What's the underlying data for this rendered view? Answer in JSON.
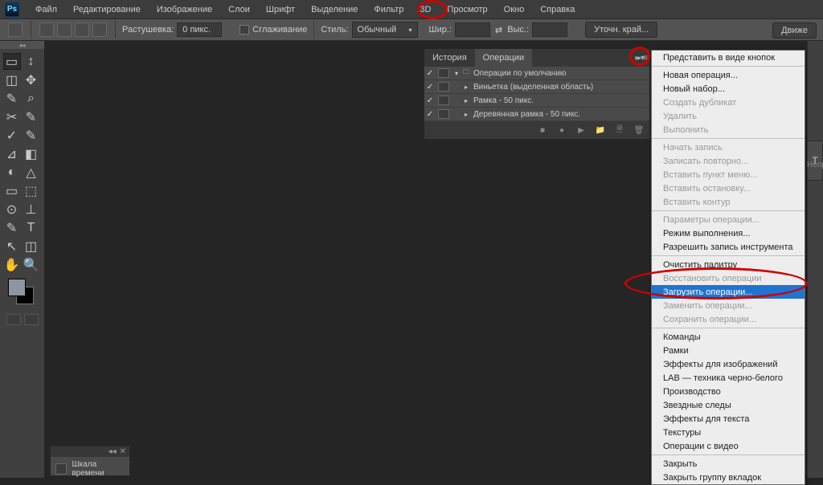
{
  "app": {
    "logo": "Ps"
  },
  "menubar": {
    "items": [
      "Файл",
      "Редактирование",
      "Изображение",
      "Слои",
      "Шрифт",
      "Выделение",
      "Фильтр",
      "3D",
      "Просмотр",
      "Окно",
      "Справка"
    ]
  },
  "optionsbar": {
    "feather_label": "Растушевка:",
    "feather_value": "0 пикс.",
    "antialias": "Сглаживание",
    "style_label": "Стиль:",
    "style_value": "Обычный",
    "width_label": "Шир.:",
    "height_label": "Выс.:",
    "refine_edge": "Уточн. край...",
    "right_btn": "Движе"
  },
  "panel": {
    "tabs": [
      "История",
      "Операции"
    ],
    "active_tab": 1,
    "rows": [
      {
        "label": "Операции по умолчанию",
        "indent": 0,
        "folder": true
      },
      {
        "label": "Виньетка (выделенная область)",
        "indent": 1,
        "folder": false
      },
      {
        "label": "Рамка - 50 пикс.",
        "indent": 1,
        "folder": false
      },
      {
        "label": "Деревянная рамка - 50 пикс.",
        "indent": 1,
        "folder": false
      }
    ],
    "footer_icons": [
      "■",
      "●",
      "▶",
      "📁",
      "🗎",
      "🗑"
    ]
  },
  "flymenu": {
    "groups": [
      [
        {
          "label": "Представить в виде кнопок",
          "disabled": false
        }
      ],
      [
        {
          "label": "Новая операция...",
          "disabled": false
        },
        {
          "label": "Новый набор...",
          "disabled": false
        },
        {
          "label": "Создать дубликат",
          "disabled": true
        },
        {
          "label": "Удалить",
          "disabled": true
        },
        {
          "label": "Выполнить",
          "disabled": true
        }
      ],
      [
        {
          "label": "Начать запись",
          "disabled": true
        },
        {
          "label": "Записать повторно...",
          "disabled": true
        },
        {
          "label": "Вставить пункт меню...",
          "disabled": true
        },
        {
          "label": "Вставить остановку...",
          "disabled": true
        },
        {
          "label": "Вставить контур",
          "disabled": true
        }
      ],
      [
        {
          "label": "Параметры операции...",
          "disabled": true
        },
        {
          "label": "Режим выполнения...",
          "disabled": false
        },
        {
          "label": "Разрешить запись инструмента",
          "disabled": false
        }
      ],
      [
        {
          "label": "Очистить палитру",
          "disabled": false
        },
        {
          "label": "Восстановить операции",
          "disabled": true
        },
        {
          "label": "Загрузить операции...",
          "disabled": false,
          "selected": true
        },
        {
          "label": "Заменить операции...",
          "disabled": true
        },
        {
          "label": "Сохранить операции...",
          "disabled": true
        }
      ],
      [
        {
          "label": "Команды",
          "disabled": false
        },
        {
          "label": "Рамки",
          "disabled": false
        },
        {
          "label": "Эффекты для изображений",
          "disabled": false
        },
        {
          "label": "LAB — техника черно-белого",
          "disabled": false
        },
        {
          "label": "Производство",
          "disabled": false
        },
        {
          "label": "Звездные следы",
          "disabled": false
        },
        {
          "label": "Эффекты для текста",
          "disabled": false
        },
        {
          "label": "Текстуры",
          "disabled": false
        },
        {
          "label": "Операции с видео",
          "disabled": false
        }
      ],
      [
        {
          "label": "Закрыть",
          "disabled": false
        },
        {
          "label": "Закрыть группу вкладок",
          "disabled": false
        }
      ]
    ]
  },
  "timeline": {
    "title": "Шкала времени"
  },
  "right_text_tab": "T",
  "right_side_label": "Непр",
  "tools_glyphs": [
    "▭",
    "↕",
    "◫",
    "✥",
    "✎",
    "⌕",
    "✂",
    "✎",
    "✓",
    "✎",
    "⊿",
    "◧",
    "◐",
    "△",
    "▭",
    "⬚",
    "⊙",
    "⊥",
    "✎",
    "T",
    "↖",
    "◫",
    "✋",
    "🔍"
  ]
}
